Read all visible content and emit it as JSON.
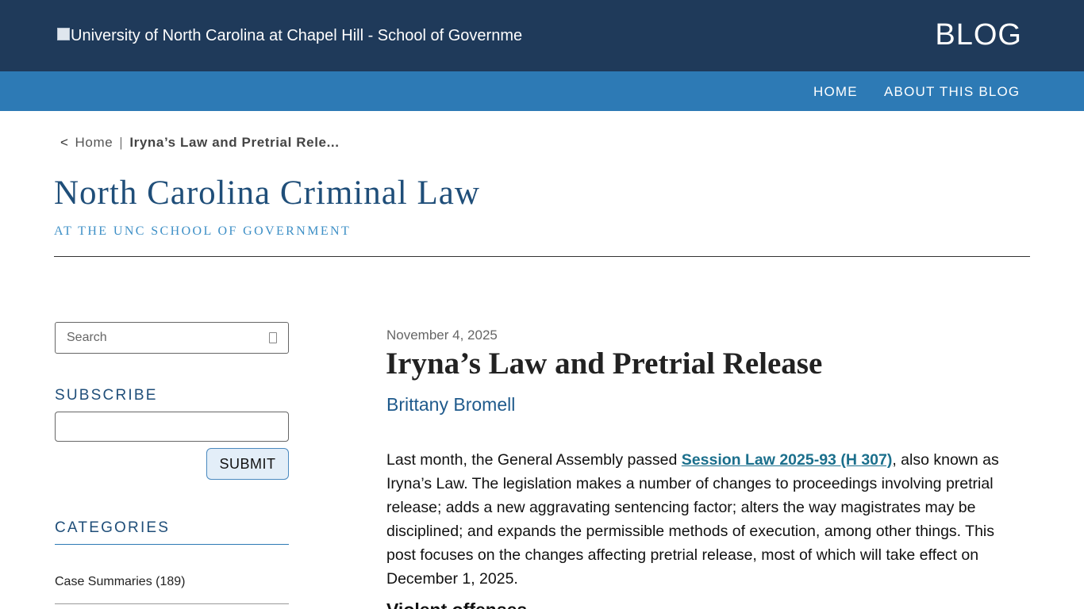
{
  "header": {
    "logo_alt": "University of North Carolina at Chapel Hill - School of Governme",
    "blog_label": "BLOG"
  },
  "nav": {
    "home": "HOME",
    "about": "ABOUT THIS BLOG"
  },
  "breadcrumb": {
    "chevron": "<",
    "home": "Home",
    "separator": "|",
    "current": "Iryna’s Law and Pretrial Rele..."
  },
  "site": {
    "title": "North Carolina Criminal Law",
    "subtitle": "AT THE UNC SCHOOL OF GOVERNMENT"
  },
  "sidebar": {
    "search_placeholder": "Search",
    "subscribe_heading": "SUBSCRIBE",
    "submit_label": "SUBMIT",
    "categories_heading": "CATEGORIES",
    "categories": [
      {
        "label": "Case Summaries (189)"
      }
    ]
  },
  "post": {
    "date": "November 4, 2025",
    "title": "Iryna’s Law and Pretrial Release",
    "author": "Brittany Bromell",
    "intro_before_link": "Last month, the General Assembly passed ",
    "link_text": "Session Law 2025-93 (H 307)",
    "intro_after_link": ", also known as Iryna’s Law. The legislation makes a number of changes to proceedings involving pretrial release; adds a new aggravating sentencing factor; alters the way magistrates may be disciplined; and expands the permissible methods of execution, among other things. This post focuses on the changes affecting pretrial release, most of which will take effect on December 1, 2025.",
    "next_heading": "Violent offenses"
  },
  "colors": {
    "topbar": "#1f3a5a",
    "navbar": "#2d7ab5",
    "title_blue": "#1f4e79",
    "subtitle_blue": "#3d8fc6",
    "link_teal": "#1b6f8c"
  }
}
